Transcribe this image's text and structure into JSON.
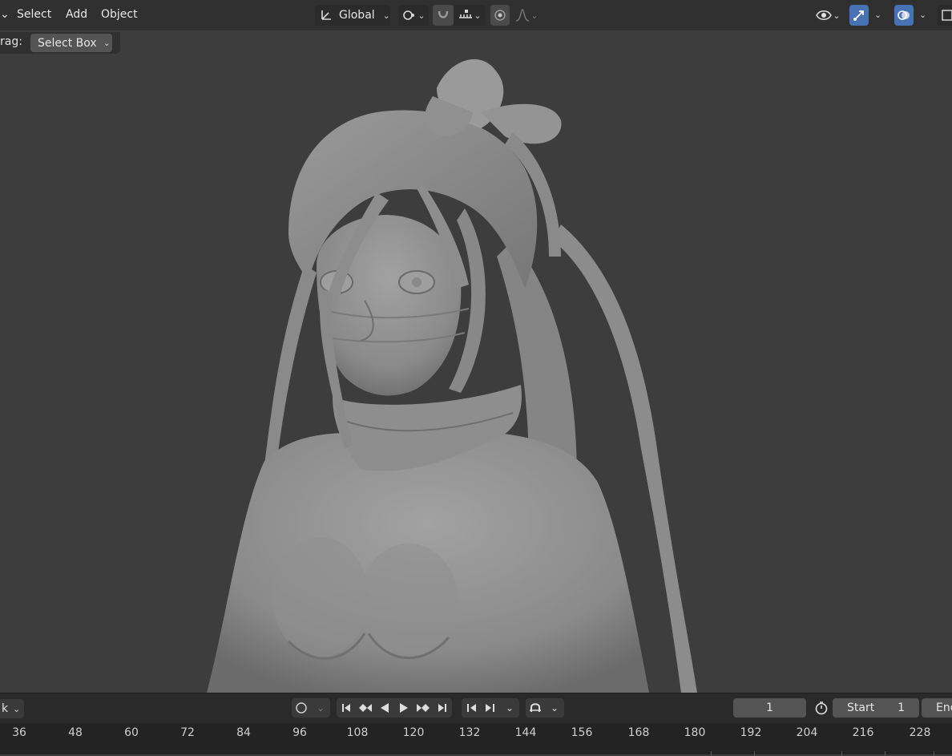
{
  "header": {
    "menu": [
      "Select",
      "Add",
      "Object"
    ],
    "transform_orientation": "Global"
  },
  "toolbar": {
    "drag_label": "rag:",
    "select_mode": "Select Box"
  },
  "timeline": {
    "mode_label": "k",
    "current_frame": "1",
    "start_label": "Start",
    "start_value": "1",
    "end_label": "End",
    "ruler_ticks": [
      "36",
      "48",
      "60",
      "72",
      "84",
      "96",
      "108",
      "120",
      "132",
      "144",
      "156",
      "168",
      "180",
      "192",
      "204",
      "216",
      "228"
    ]
  },
  "colors": {
    "accent": "#4772b3",
    "viewport_bg": "#3d3d3d",
    "header_bg": "#303030"
  }
}
